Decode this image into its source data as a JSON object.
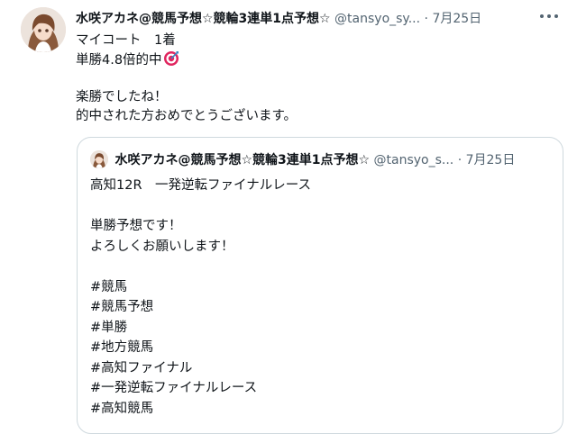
{
  "tweet": {
    "avatar_icon": "profile-avatar-anime-girl",
    "display_name": "水咲アカネ@競馬予想☆競輪3連単1点予想☆",
    "handle": "@tansyo_sy...",
    "separator": "·",
    "date": "7月25日",
    "more_icon": "ellipsis-icon",
    "lines": [
      "マイコート　1着",
      "単勝4.8倍的中"
    ],
    "target_icon": "direct-hit-icon",
    "lines2": [
      "楽勝でしたね！",
      "的中された方おめでとうございます。"
    ]
  },
  "quote": {
    "display_name": "水咲アカネ@競馬予想☆競輪3連単1点予想☆",
    "handle": "@tansyo_s...",
    "separator": "·",
    "date": "7月25日",
    "lines": [
      "高知12R　一発逆転ファイナルレース"
    ],
    "lines2": [
      "単勝予想です！",
      "よろしくお願いします！"
    ],
    "hashtags": [
      "#競馬",
      "#競馬予想",
      "#単勝",
      "#地方競馬",
      "#高知ファイナル",
      "#一発逆転ファイナルレース",
      "#高知競馬"
    ]
  },
  "colors": {
    "text": "#0f1419",
    "muted": "#536471",
    "border": "#cfd9de",
    "target_red": "#e0245e"
  }
}
